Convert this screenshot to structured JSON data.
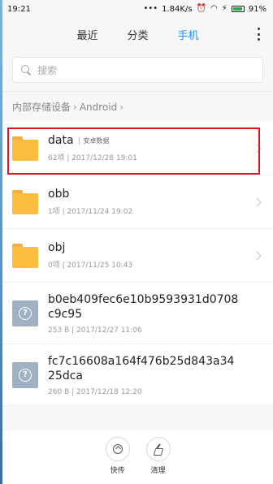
{
  "status_bar": {
    "time": "19:21",
    "speed": "1.84K/s",
    "battery": "91%"
  },
  "tabs": [
    {
      "label": "最近",
      "active": false
    },
    {
      "label": "分类",
      "active": false
    },
    {
      "label": "手机",
      "active": true
    }
  ],
  "search": {
    "placeholder": "搜索"
  },
  "breadcrumb": {
    "items": [
      "内部存储设备",
      "Android"
    ]
  },
  "files": [
    {
      "name": "data",
      "tag": "安卓数据",
      "meta": "62项 | 2017/12/28 19:01",
      "icon": "folder-icon"
    },
    {
      "name": "obb",
      "tag": "",
      "meta": "1项 | 2017/11/24 19:02",
      "icon": "folder-icon"
    },
    {
      "name": "obj",
      "tag": "",
      "meta": "0项 | 2017/11/25 10:43",
      "icon": "folder-icon"
    },
    {
      "name": "b0eb409fec6e10b9593931d0708c9c95",
      "tag": "",
      "meta": "253 B | 2017/12/27 11:06",
      "icon": "unknown-file-icon"
    },
    {
      "name": "fc7c16608a164f476b25d843a3425dca",
      "tag": "",
      "meta": "260 B | 2017/12/18 12:20",
      "icon": "unknown-file-icon"
    }
  ],
  "bottom_bar": {
    "send_label": "快传",
    "clean_label": "清理"
  },
  "colors": {
    "accent": "#1e90ff",
    "folder": "#fbbd3f",
    "highlight": "#e0141e"
  }
}
